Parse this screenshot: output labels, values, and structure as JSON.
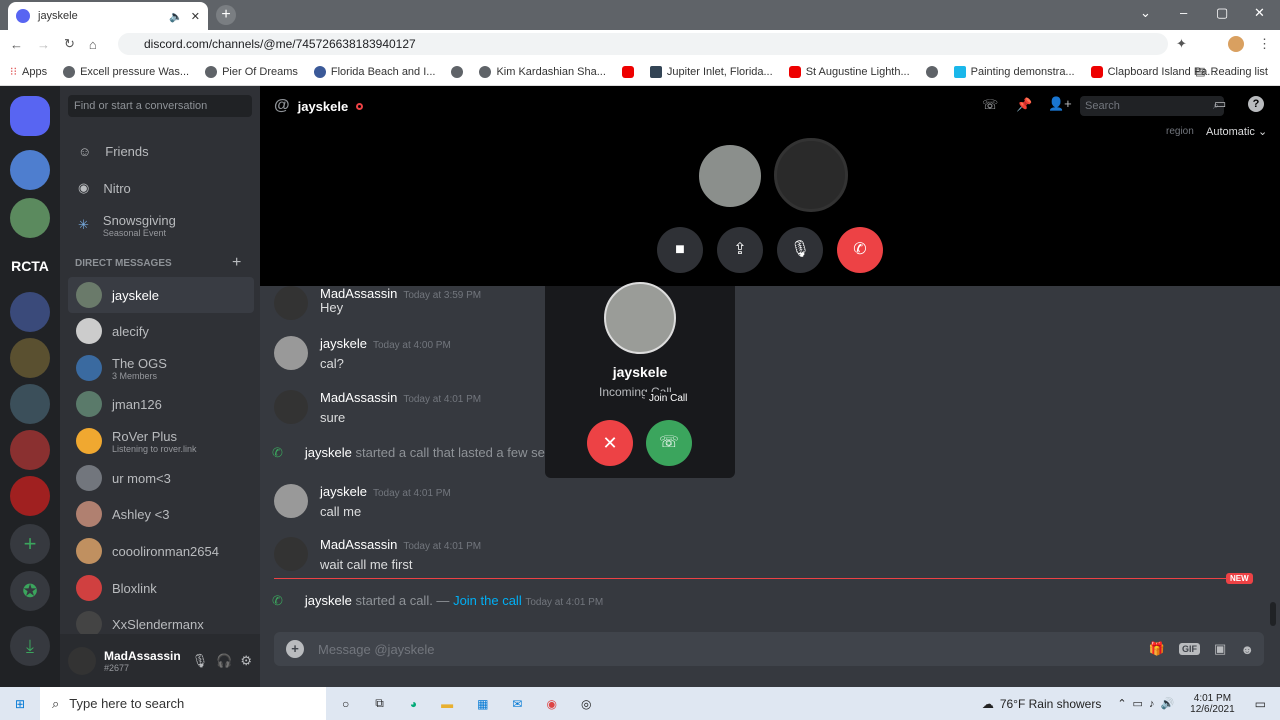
{
  "browser": {
    "tab_title": "jayskele",
    "url": "discord.com/channels/@me/745726638183940127",
    "bookmarks": [
      "Apps",
      "Excell pressure Was...",
      "Pier Of Dreams",
      "Florida Beach and I...",
      "",
      "Kim Kardashian Sha...",
      "",
      "Jupiter Inlet, Florida...",
      "St Augustine Lighth...",
      "",
      "Painting demonstra...",
      "Clapboard Island Pa..."
    ],
    "reading_list": "Reading list"
  },
  "sidebar": {
    "search_placeholder": "Find or start a conversation",
    "nav": [
      {
        "label": "Friends"
      },
      {
        "label": "Nitro"
      },
      {
        "label": "Snowsgiving",
        "sub": "Seasonal Event"
      }
    ],
    "dm_header": "DIRECT MESSAGES",
    "dms": [
      {
        "name": "jayskele"
      },
      {
        "name": "alecify"
      },
      {
        "name": "The OGS",
        "sub": "3 Members"
      },
      {
        "name": "jman126"
      },
      {
        "name": "RoVer Plus",
        "sub": "Listening to rover.link"
      },
      {
        "name": "ur mom<3"
      },
      {
        "name": "Ashley <3"
      },
      {
        "name": "cooolironman2654"
      },
      {
        "name": "Bloxlink"
      },
      {
        "name": "XxSlendermanx"
      }
    ],
    "guild_label": "RCTA",
    "user": {
      "name": "MadAssassin",
      "tag": "#2677"
    }
  },
  "header": {
    "channel": "jayskele",
    "search_placeholder": "Search",
    "region_label": "region",
    "region_value": "Automatic"
  },
  "messages": [
    {
      "author": "MadAssassin",
      "time": "Today at 3:59 PM",
      "text": "Hey"
    },
    {
      "author": "jayskele",
      "time": "Today at 4:00 PM",
      "text": "cal?"
    },
    {
      "author": "MadAssassin",
      "time": "Today at 4:01 PM",
      "text": "sure"
    },
    {
      "author": "jayskele",
      "time": "Today at 4:01 PM",
      "text": "call me"
    },
    {
      "author": "MadAssassin",
      "time": "Today at 4:01 PM",
      "text": "wait call me first"
    }
  ],
  "system": [
    {
      "author": "jayskele",
      "text": "started a call that lasted a few se"
    },
    {
      "author": "jayskele",
      "text": "started a call. —",
      "link": "Join the call",
      "time": "Today at 4:01 PM"
    }
  ],
  "new_badge": "NEW",
  "popup": {
    "name": "jayskele",
    "status": "Incoming Call",
    "tooltip": "Join Call"
  },
  "composer": {
    "placeholder": "Message @jayskele",
    "gif": "GIF"
  },
  "taskbar": {
    "search": "Type here to search",
    "weather": "76°F  Rain showers",
    "time": "4:01 PM",
    "date": "12/6/2021"
  },
  "colors": {
    "blurple": "#5865f2",
    "green": "#3ba55d",
    "red": "#ed4245",
    "link": "#00aff4"
  }
}
